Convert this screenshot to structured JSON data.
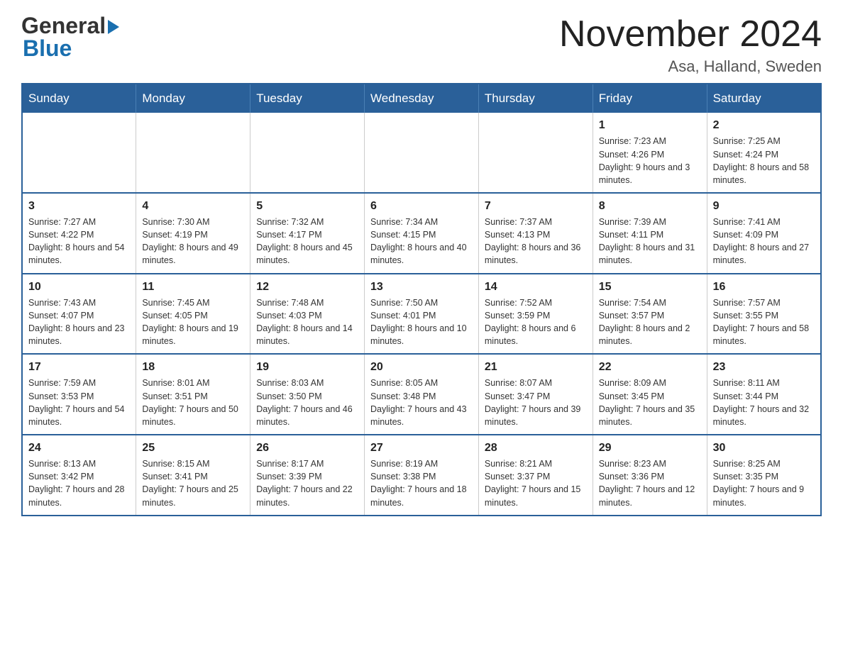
{
  "header": {
    "logo_general": "General",
    "logo_blue": "Blue",
    "month_title": "November 2024",
    "location": "Asa, Halland, Sweden"
  },
  "calendar": {
    "headers": [
      "Sunday",
      "Monday",
      "Tuesday",
      "Wednesday",
      "Thursday",
      "Friday",
      "Saturday"
    ],
    "rows": [
      [
        {
          "day": "",
          "sunrise": "",
          "sunset": "",
          "daylight": ""
        },
        {
          "day": "",
          "sunrise": "",
          "sunset": "",
          "daylight": ""
        },
        {
          "day": "",
          "sunrise": "",
          "sunset": "",
          "daylight": ""
        },
        {
          "day": "",
          "sunrise": "",
          "sunset": "",
          "daylight": ""
        },
        {
          "day": "",
          "sunrise": "",
          "sunset": "",
          "daylight": ""
        },
        {
          "day": "1",
          "sunrise": "Sunrise: 7:23 AM",
          "sunset": "Sunset: 4:26 PM",
          "daylight": "Daylight: 9 hours and 3 minutes."
        },
        {
          "day": "2",
          "sunrise": "Sunrise: 7:25 AM",
          "sunset": "Sunset: 4:24 PM",
          "daylight": "Daylight: 8 hours and 58 minutes."
        }
      ],
      [
        {
          "day": "3",
          "sunrise": "Sunrise: 7:27 AM",
          "sunset": "Sunset: 4:22 PM",
          "daylight": "Daylight: 8 hours and 54 minutes."
        },
        {
          "day": "4",
          "sunrise": "Sunrise: 7:30 AM",
          "sunset": "Sunset: 4:19 PM",
          "daylight": "Daylight: 8 hours and 49 minutes."
        },
        {
          "day": "5",
          "sunrise": "Sunrise: 7:32 AM",
          "sunset": "Sunset: 4:17 PM",
          "daylight": "Daylight: 8 hours and 45 minutes."
        },
        {
          "day": "6",
          "sunrise": "Sunrise: 7:34 AM",
          "sunset": "Sunset: 4:15 PM",
          "daylight": "Daylight: 8 hours and 40 minutes."
        },
        {
          "day": "7",
          "sunrise": "Sunrise: 7:37 AM",
          "sunset": "Sunset: 4:13 PM",
          "daylight": "Daylight: 8 hours and 36 minutes."
        },
        {
          "day": "8",
          "sunrise": "Sunrise: 7:39 AM",
          "sunset": "Sunset: 4:11 PM",
          "daylight": "Daylight: 8 hours and 31 minutes."
        },
        {
          "day": "9",
          "sunrise": "Sunrise: 7:41 AM",
          "sunset": "Sunset: 4:09 PM",
          "daylight": "Daylight: 8 hours and 27 minutes."
        }
      ],
      [
        {
          "day": "10",
          "sunrise": "Sunrise: 7:43 AM",
          "sunset": "Sunset: 4:07 PM",
          "daylight": "Daylight: 8 hours and 23 minutes."
        },
        {
          "day": "11",
          "sunrise": "Sunrise: 7:45 AM",
          "sunset": "Sunset: 4:05 PM",
          "daylight": "Daylight: 8 hours and 19 minutes."
        },
        {
          "day": "12",
          "sunrise": "Sunrise: 7:48 AM",
          "sunset": "Sunset: 4:03 PM",
          "daylight": "Daylight: 8 hours and 14 minutes."
        },
        {
          "day": "13",
          "sunrise": "Sunrise: 7:50 AM",
          "sunset": "Sunset: 4:01 PM",
          "daylight": "Daylight: 8 hours and 10 minutes."
        },
        {
          "day": "14",
          "sunrise": "Sunrise: 7:52 AM",
          "sunset": "Sunset: 3:59 PM",
          "daylight": "Daylight: 8 hours and 6 minutes."
        },
        {
          "day": "15",
          "sunrise": "Sunrise: 7:54 AM",
          "sunset": "Sunset: 3:57 PM",
          "daylight": "Daylight: 8 hours and 2 minutes."
        },
        {
          "day": "16",
          "sunrise": "Sunrise: 7:57 AM",
          "sunset": "Sunset: 3:55 PM",
          "daylight": "Daylight: 7 hours and 58 minutes."
        }
      ],
      [
        {
          "day": "17",
          "sunrise": "Sunrise: 7:59 AM",
          "sunset": "Sunset: 3:53 PM",
          "daylight": "Daylight: 7 hours and 54 minutes."
        },
        {
          "day": "18",
          "sunrise": "Sunrise: 8:01 AM",
          "sunset": "Sunset: 3:51 PM",
          "daylight": "Daylight: 7 hours and 50 minutes."
        },
        {
          "day": "19",
          "sunrise": "Sunrise: 8:03 AM",
          "sunset": "Sunset: 3:50 PM",
          "daylight": "Daylight: 7 hours and 46 minutes."
        },
        {
          "day": "20",
          "sunrise": "Sunrise: 8:05 AM",
          "sunset": "Sunset: 3:48 PM",
          "daylight": "Daylight: 7 hours and 43 minutes."
        },
        {
          "day": "21",
          "sunrise": "Sunrise: 8:07 AM",
          "sunset": "Sunset: 3:47 PM",
          "daylight": "Daylight: 7 hours and 39 minutes."
        },
        {
          "day": "22",
          "sunrise": "Sunrise: 8:09 AM",
          "sunset": "Sunset: 3:45 PM",
          "daylight": "Daylight: 7 hours and 35 minutes."
        },
        {
          "day": "23",
          "sunrise": "Sunrise: 8:11 AM",
          "sunset": "Sunset: 3:44 PM",
          "daylight": "Daylight: 7 hours and 32 minutes."
        }
      ],
      [
        {
          "day": "24",
          "sunrise": "Sunrise: 8:13 AM",
          "sunset": "Sunset: 3:42 PM",
          "daylight": "Daylight: 7 hours and 28 minutes."
        },
        {
          "day": "25",
          "sunrise": "Sunrise: 8:15 AM",
          "sunset": "Sunset: 3:41 PM",
          "daylight": "Daylight: 7 hours and 25 minutes."
        },
        {
          "day": "26",
          "sunrise": "Sunrise: 8:17 AM",
          "sunset": "Sunset: 3:39 PM",
          "daylight": "Daylight: 7 hours and 22 minutes."
        },
        {
          "day": "27",
          "sunrise": "Sunrise: 8:19 AM",
          "sunset": "Sunset: 3:38 PM",
          "daylight": "Daylight: 7 hours and 18 minutes."
        },
        {
          "day": "28",
          "sunrise": "Sunrise: 8:21 AM",
          "sunset": "Sunset: 3:37 PM",
          "daylight": "Daylight: 7 hours and 15 minutes."
        },
        {
          "day": "29",
          "sunrise": "Sunrise: 8:23 AM",
          "sunset": "Sunset: 3:36 PM",
          "daylight": "Daylight: 7 hours and 12 minutes."
        },
        {
          "day": "30",
          "sunrise": "Sunrise: 8:25 AM",
          "sunset": "Sunset: 3:35 PM",
          "daylight": "Daylight: 7 hours and 9 minutes."
        }
      ]
    ]
  }
}
